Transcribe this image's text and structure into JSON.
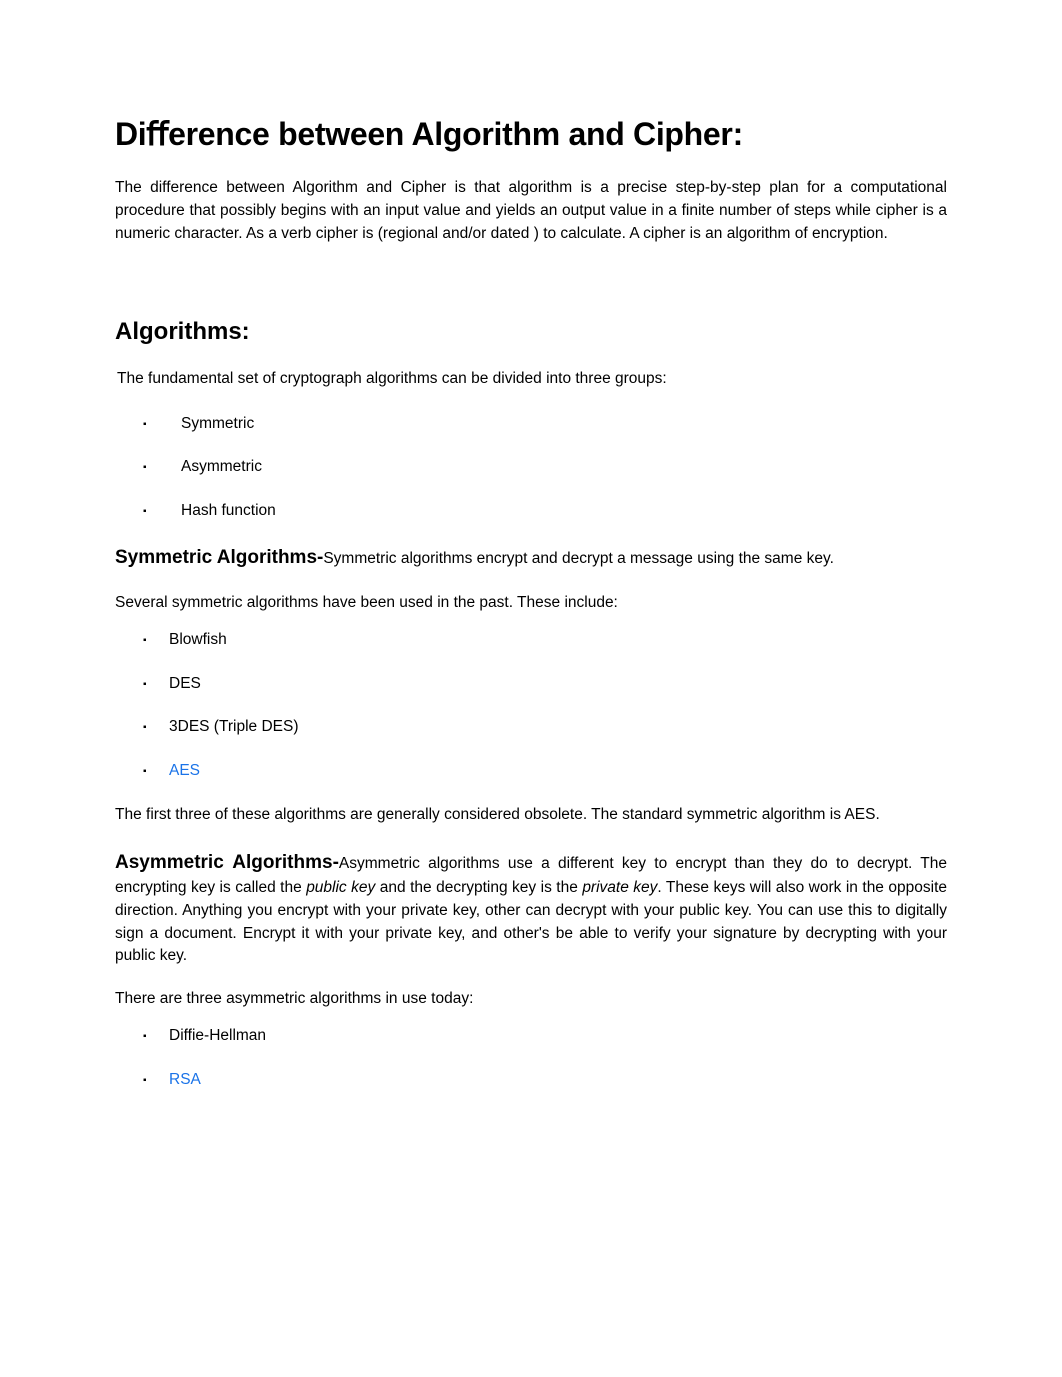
{
  "title": "Diﬀerence between Algorithm and Cipher:",
  "intro_para": "The difference between Algorithm and Cipher is that algorithm is a precise step-by-step plan for a computational procedure that possibly begins with an input value and yields an output value in a finite number of steps while cipher is a numeric character. As a verb cipher is  (regional and/or dated ) to calculate. A cipher is an algorithm of encryption.",
  "section_algorithms": {
    "heading": "Algorithms:",
    "intro": "The fundamental set of cryptograph algorithms can be divided into three groups:",
    "groups": [
      "Symmetric",
      "Asymmetric",
      "Hash function"
    ]
  },
  "symmetric": {
    "heading": "Symmetric Algorithms-",
    "desc": "Symmetric algorithms encrypt and decrypt a message using the same key.",
    "past_intro": "Several symmetric algorithms have been used in the past. These include:",
    "list": [
      "Blowfish",
      "DES",
      "3DES (Triple DES)"
    ],
    "list_link": "AES",
    "note": "The first three of these algorithms are generally considered obsolete. The standard symmetric algorithm is AES."
  },
  "asymmetric": {
    "heading": "Asymmetric Algorithms-",
    "desc_1": "Asymmetric algorithms use a different key to encrypt than they do to decrypt. The encrypting key is called the ",
    "public_key": "public key",
    "desc_2": " and the decrypting key is the ",
    "private_key": "private key",
    "desc_3": ". These keys will also work in the opposite direction. Anything you encrypt with your private key, other can decrypt with your public key. You can use this to digitally sign a document. Encrypt it with your private key, and other's be able to verify your signature by decrypting with your public key.",
    "today_intro": "There are three asymmetric algorithms in use today:",
    "list": [
      "Diffie-Hellman"
    ],
    "list_link": "RSA"
  }
}
